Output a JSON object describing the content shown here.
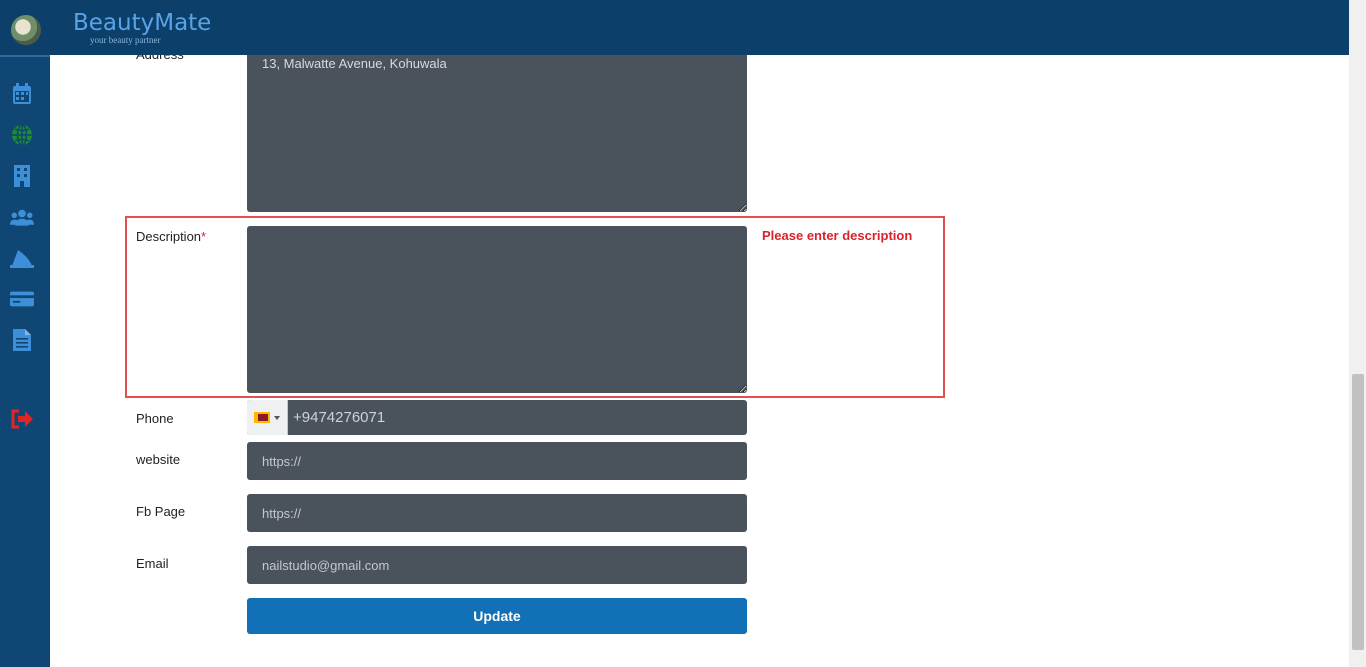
{
  "header": {
    "brand": "BeautyMate",
    "tagline": "your beauty partner"
  },
  "sidebar": {
    "icons": [
      {
        "name": "calendar-icon"
      },
      {
        "name": "globe-icon",
        "color": "#1a8f2d"
      },
      {
        "name": "building-icon"
      },
      {
        "name": "users-icon"
      },
      {
        "name": "shark-fin-icon"
      },
      {
        "name": "credit-card-icon"
      },
      {
        "name": "document-icon"
      },
      {
        "name": "logout-icon",
        "color": "#e02525"
      }
    ]
  },
  "form": {
    "address": {
      "label": "Address",
      "value": "13, Malwatte Avenue, Kohuwala"
    },
    "description": {
      "label": "Description",
      "required_mark": "*",
      "value": "",
      "error": "Please enter description"
    },
    "phone": {
      "label": "Phone",
      "value": "+9474276071",
      "country": "LK"
    },
    "website": {
      "label": "website",
      "placeholder": "https://"
    },
    "fb_page": {
      "label": "Fb Page",
      "placeholder": "https://"
    },
    "email": {
      "label": "Email",
      "placeholder": "nailstudio@gmail.com"
    },
    "update_label": "Update"
  },
  "colors": {
    "header_bg": "#0c3f6a",
    "sidebar_bg": "#0f4673",
    "field_bg": "#4a525b",
    "error": "#d9232b",
    "button": "#1170b6"
  }
}
